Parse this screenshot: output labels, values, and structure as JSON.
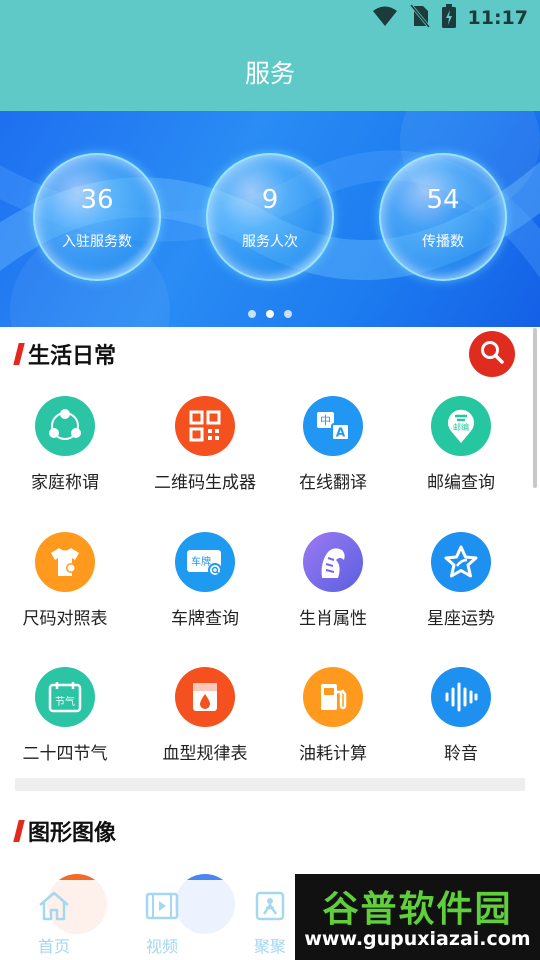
{
  "status_bar": {
    "time": "11:17",
    "icons": [
      "wifi-icon",
      "no-sim-icon",
      "battery-charging-icon"
    ]
  },
  "header": {
    "title": "服务"
  },
  "banner": {
    "stats": [
      {
        "value": "36",
        "label": "入驻服务数"
      },
      {
        "value": "9",
        "label": "服务人次"
      },
      {
        "value": "54",
        "label": "传播数"
      }
    ],
    "pager": {
      "count": 3,
      "active": 1
    }
  },
  "sections": {
    "life": {
      "title": "生活日常",
      "items": [
        {
          "label": "家庭称谓",
          "icon": "family-icon",
          "color": "#2bc5a6"
        },
        {
          "label": "二维码生成器",
          "icon": "qr-code-icon",
          "color": "#f4511e"
        },
        {
          "label": "在线翻译",
          "icon": "translate-icon",
          "color": "#2196f3"
        },
        {
          "label": "邮编查询",
          "icon": "postcode-icon",
          "color": "#26c6a0"
        },
        {
          "label": "尺码对照表",
          "icon": "tshirt-icon",
          "color": "#ff9a1f"
        },
        {
          "label": "车牌查询",
          "icon": "license-plate-icon",
          "color": "#1e9af0"
        },
        {
          "label": "生肖属性",
          "icon": "tiger-icon",
          "color": "#7c67e8"
        },
        {
          "label": "星座运势",
          "icon": "star-icon",
          "color": "#1e90f0"
        },
        {
          "label": "二十四节气",
          "icon": "calendar-icon",
          "color": "#2bc5a6"
        },
        {
          "label": "血型规律表",
          "icon": "blood-type-icon",
          "color": "#f4511e"
        },
        {
          "label": "油耗计算",
          "icon": "fuel-icon",
          "color": "#ff9a1f"
        },
        {
          "label": "聆音",
          "icon": "sound-wave-icon",
          "color": "#1e90f0"
        }
      ],
      "calendar_text": "节气",
      "translate_text_a": "中",
      "translate_text_b": "A",
      "plate_text": "车牌",
      "post_text": "邮编"
    },
    "graphics": {
      "title": "图形图像"
    }
  },
  "bottom_nav": [
    {
      "label": "首页",
      "icon": "home-icon"
    },
    {
      "label": "视频",
      "icon": "video-icon"
    },
    {
      "label": "聚聚",
      "icon": "fun-icon"
    }
  ],
  "watermark": {
    "top": "谷普软件园",
    "bottom": "www.gupuxiazai.com"
  },
  "colors": {
    "primary": "#5ec9c6",
    "accent_red": "#e02c1f",
    "banner_blue": "#1e7cf0",
    "nav_label": "#a4d7f0"
  }
}
